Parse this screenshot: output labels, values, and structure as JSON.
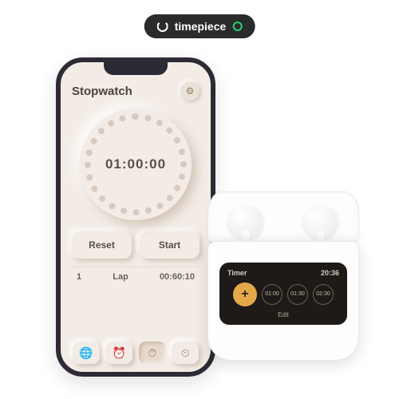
{
  "brand": {
    "name": "timepiece"
  },
  "phone": {
    "title": "Stopwatch",
    "main_time": "01:00:00",
    "buttons": {
      "reset": "Reset",
      "start": "Start"
    },
    "lap": {
      "index": "1",
      "label": "Lap",
      "time": "00:60:10"
    },
    "tabs": {
      "world": "globe-icon",
      "alarm": "alarm-icon",
      "stopwatch": "stopwatch-icon",
      "timer": "timer-icon"
    }
  },
  "case_screen": {
    "title": "Timer",
    "clock": "20:36",
    "add_label": "+",
    "presets": [
      "01:00",
      "01:30",
      "02:30"
    ],
    "edit": "Edit"
  }
}
